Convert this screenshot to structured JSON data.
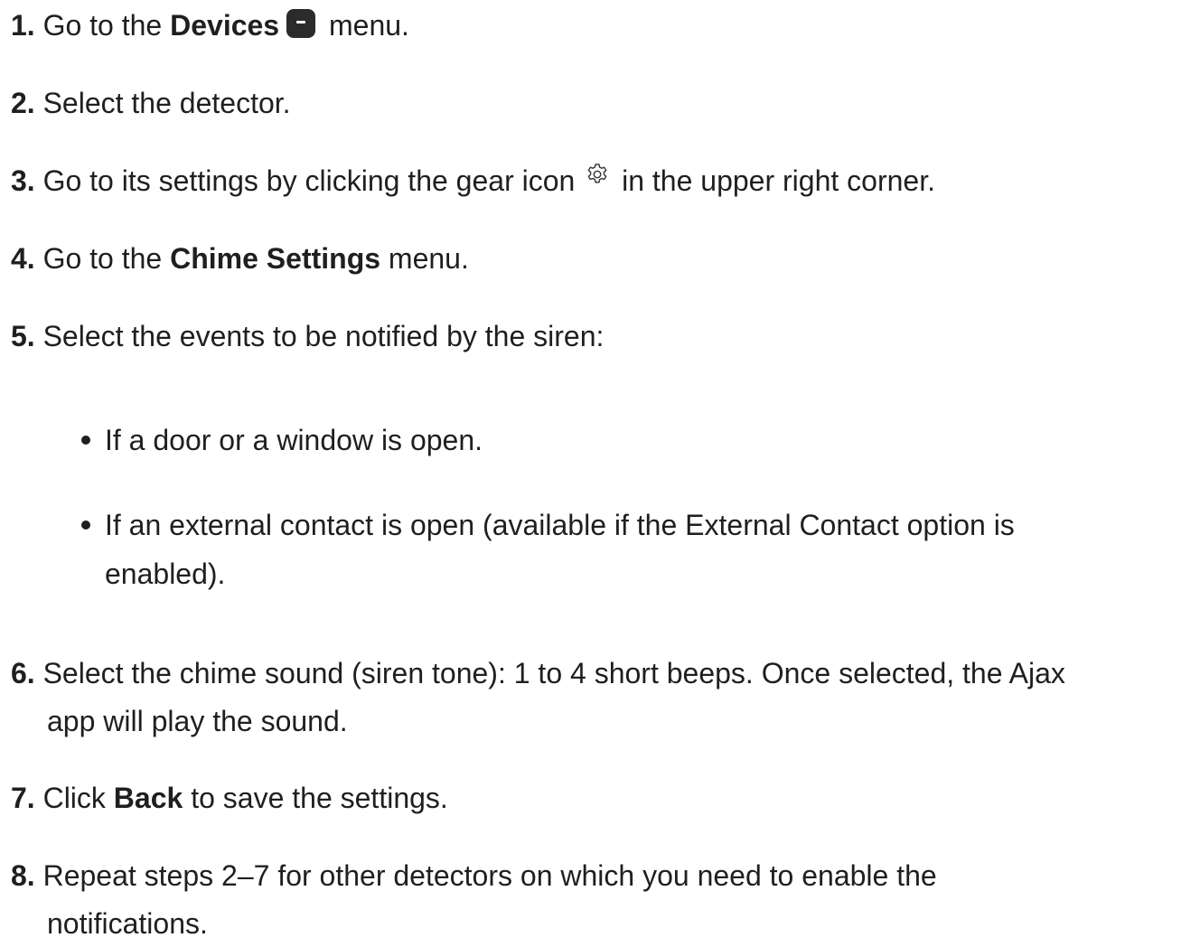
{
  "steps": [
    {
      "num": "1.",
      "pre": "Go to the ",
      "bold": "Devices",
      "post": " menu."
    },
    {
      "num": "2.",
      "text": "Select the detector."
    },
    {
      "num": "3.",
      "pre": "Go to its settings by clicking the gear icon ",
      "post": " in the upper right corner."
    },
    {
      "num": "4.",
      "pre": "Go to the ",
      "bold": "Chime Settings",
      "post": " menu."
    },
    {
      "num": "5.",
      "text": "Select the events to be notified by the siren:"
    },
    {
      "num": "6.",
      "line1": "Select the chime sound (siren tone): 1 to 4 short beeps. Once selected, the Ajax",
      "line2": "app will play the sound."
    },
    {
      "num": "7.",
      "pre": "Click ",
      "bold": "Back",
      "post": " to save the settings."
    },
    {
      "num": "8.",
      "line1": "Repeat steps 2–7 for other detectors on which you need to enable the",
      "line2": "notifications."
    }
  ],
  "bullets": [
    {
      "line1": "If a door or a window is open."
    },
    {
      "line1": "If an external contact is open (available if the External Contact option is",
      "line2": "enabled)."
    }
  ],
  "icons": {
    "devices": "devices-icon",
    "gear": "gear-icon"
  }
}
